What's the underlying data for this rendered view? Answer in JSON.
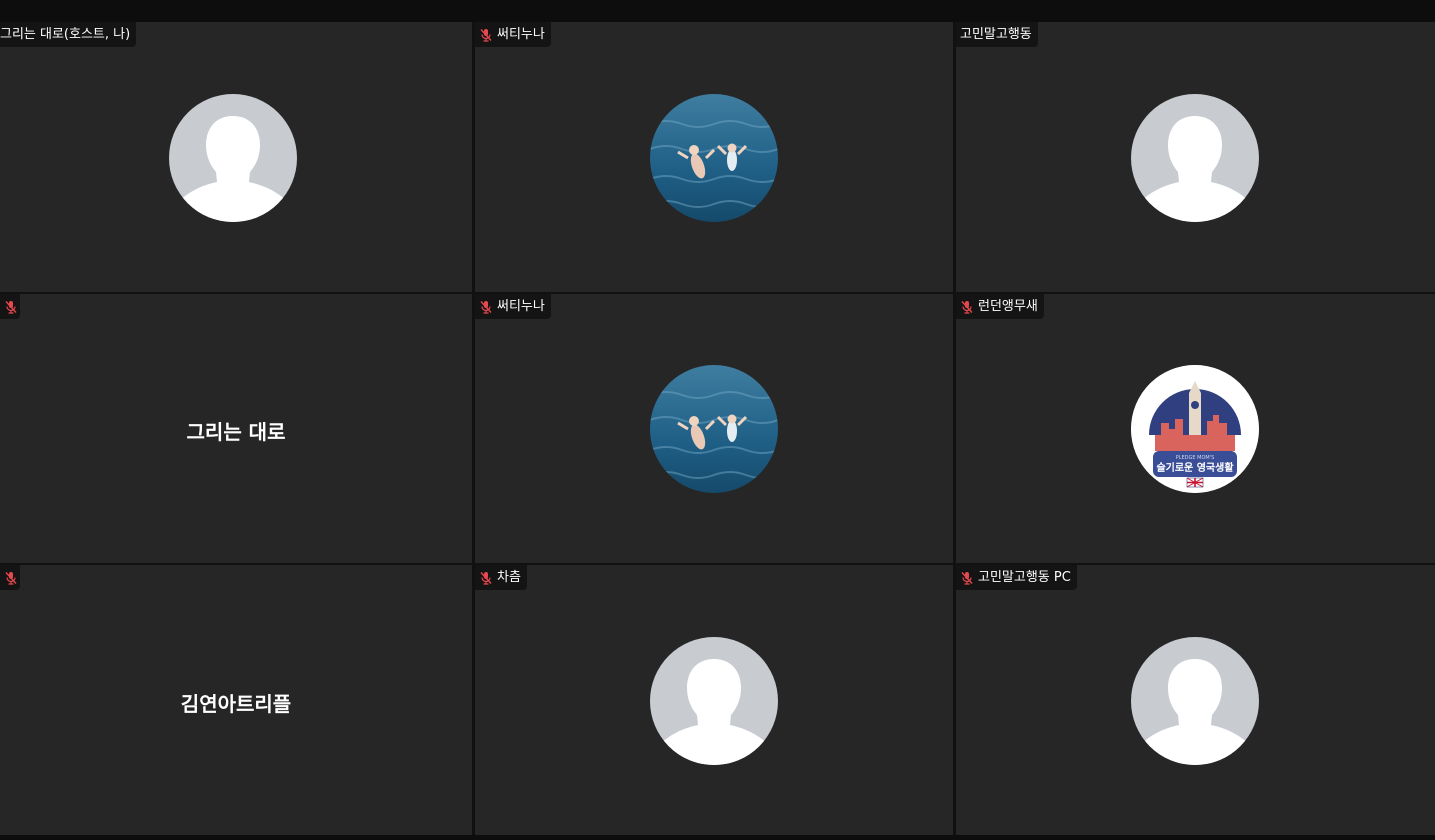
{
  "tiles": [
    {
      "label": "그리는 대로(호스트, 나)",
      "muted": false,
      "avatar": "default-avatar"
    },
    {
      "label": "써티누나",
      "muted": true,
      "avatar": "ocean-photo"
    },
    {
      "label": "고민말고행동",
      "muted": false,
      "avatar": "default-avatar"
    },
    {
      "label": "",
      "muted": true,
      "center_name": "그리는 대로"
    },
    {
      "label": "써티누나",
      "muted": true,
      "avatar": "ocean-photo"
    },
    {
      "label": "런던앵무새",
      "muted": true,
      "avatar": "london-logo",
      "logo": {
        "line1": "PLEDGE MOM'S",
        "line2": "슬기로운 영국생활"
      }
    },
    {
      "label": "",
      "muted": true,
      "center_name": "김연아트리플"
    },
    {
      "label": "차츰",
      "muted": true,
      "avatar": "default-avatar"
    },
    {
      "label": "고민말고행동 PC",
      "muted": true,
      "avatar": "default-avatar"
    }
  ],
  "colors": {
    "tile_bg": "#262626",
    "label_bg": "#141414",
    "muted_mic": "#e5484d",
    "avatar_bg": "#c8cbd0",
    "avatar_fg": "#ffffff"
  }
}
